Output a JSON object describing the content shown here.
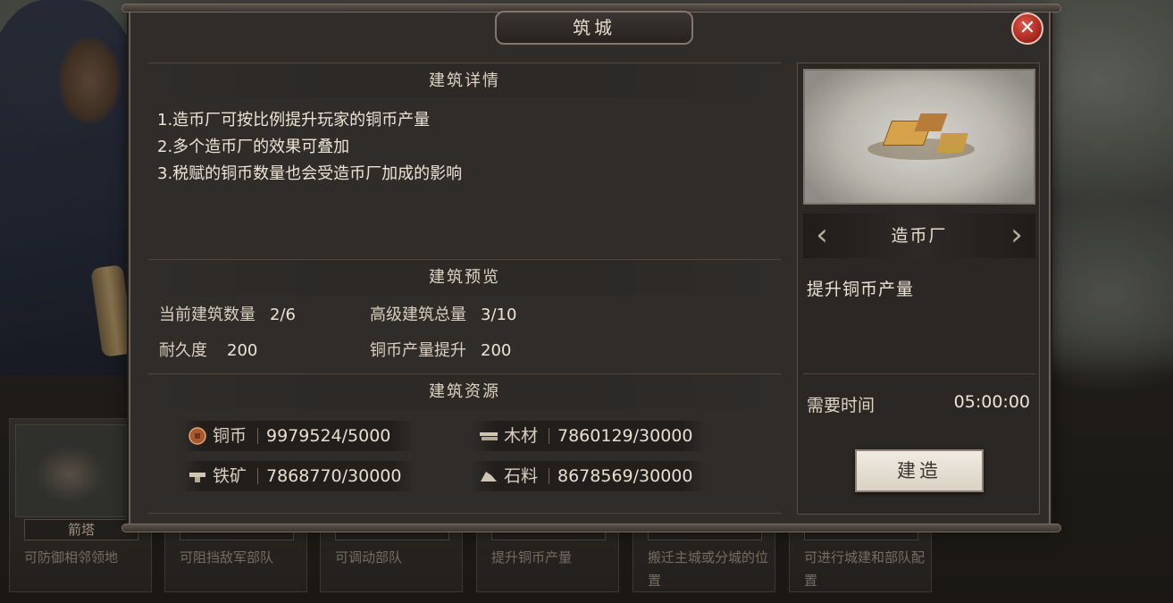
{
  "dialog": {
    "title": "筑城",
    "close_icon": "close-icon"
  },
  "details": {
    "heading": "建筑详情",
    "lines": [
      "1.造币厂可按比例提升玩家的铜币产量",
      "2.多个造币厂的效果可叠加",
      "3.税赋的铜币数量也会受造币厂加成的影响"
    ]
  },
  "preview_section": {
    "heading": "建筑预览",
    "stats": [
      {
        "label": "当前建筑数量",
        "value": "2/6"
      },
      {
        "label": "高级建筑总量",
        "value": "3/10"
      },
      {
        "label": "耐久度",
        "value": "200"
      },
      {
        "label": "铜币产量提升",
        "value": "200"
      }
    ]
  },
  "resources": {
    "heading": "建筑资源",
    "items": [
      {
        "name": "铜币",
        "value": "9979524/5000",
        "icon": "copper-coin-icon",
        "color": "#b0633a"
      },
      {
        "name": "木材",
        "value": "7860129/30000",
        "icon": "wood-icon",
        "color": "#cfc6b4"
      },
      {
        "name": "铁矿",
        "value": "7868770/30000",
        "icon": "iron-ore-icon",
        "color": "#cfc6b4"
      },
      {
        "name": "石料",
        "value": "8678569/30000",
        "icon": "stone-icon",
        "color": "#cfc6b4"
      }
    ]
  },
  "side": {
    "building_name": "造币厂",
    "prev_arrow": "‹",
    "next_arrow": "›",
    "description": "提升铜币产量",
    "time_label": "需要时间",
    "time_value": "05:00:00",
    "build_button": "建造"
  },
  "background_cards": [
    {
      "name": "箭塔",
      "desc": "可防御相邻领地"
    },
    {
      "name": "",
      "desc": "可阻挡敌军部队"
    },
    {
      "name": "",
      "desc": "可调动部队"
    },
    {
      "name": "",
      "desc": "提升铜币产量"
    },
    {
      "name": "",
      "desc": "搬迁主城或分城的位置"
    },
    {
      "name": "",
      "desc": "可进行城建和部队配置"
    }
  ],
  "colors": {
    "accent_close": "#c1362b",
    "panel_bg": "#2f2c2a",
    "border": "#6d6259"
  }
}
